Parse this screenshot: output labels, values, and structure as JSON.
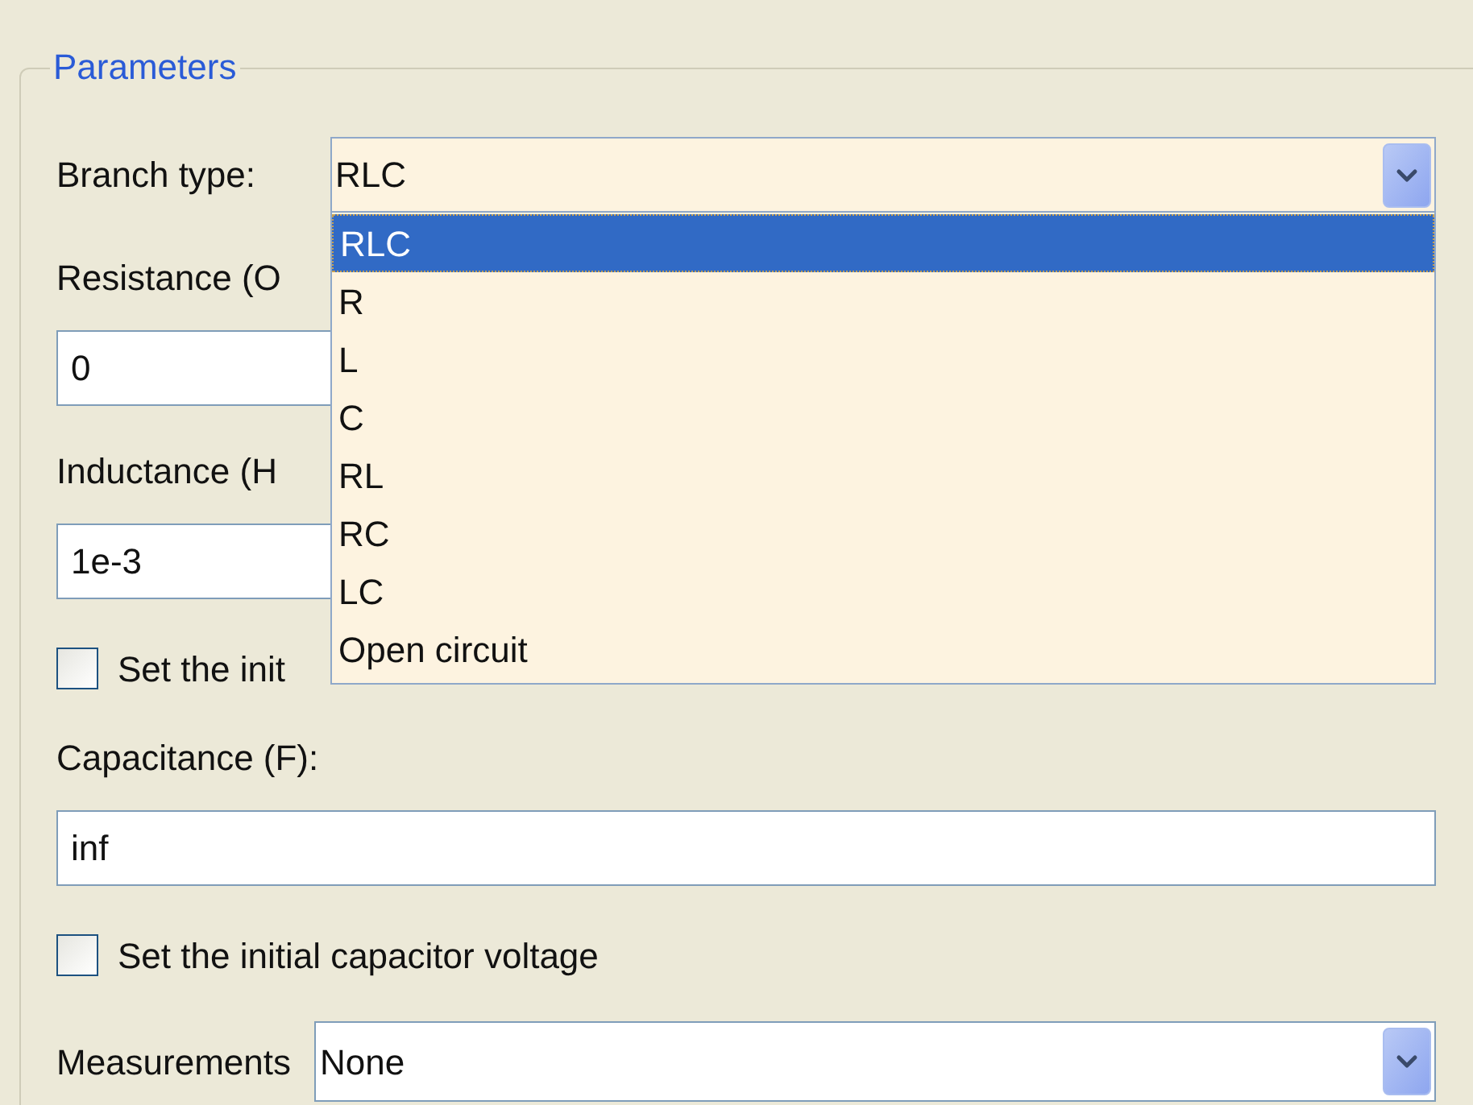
{
  "group": {
    "title": "Parameters"
  },
  "branch_type": {
    "label": "Branch type:",
    "value": "RLC",
    "expanded": true,
    "options": [
      {
        "label": "RLC",
        "selected": true
      },
      {
        "label": "R",
        "selected": false
      },
      {
        "label": "L",
        "selected": false
      },
      {
        "label": "C",
        "selected": false
      },
      {
        "label": "RL",
        "selected": false
      },
      {
        "label": "RC",
        "selected": false
      },
      {
        "label": "LC",
        "selected": false
      },
      {
        "label": "Open circuit",
        "selected": false
      }
    ]
  },
  "fields": [
    {
      "kind": "text",
      "label": "Resistance (O",
      "value": "0"
    },
    {
      "kind": "text",
      "label": "Inductance (H",
      "value": "1e-3"
    },
    {
      "kind": "checkbox",
      "label": "Set the init",
      "checked": false
    },
    {
      "kind": "text",
      "label": "Capacitance (F):",
      "value": "inf"
    },
    {
      "kind": "checkbox",
      "label": "Set the initial capacitor voltage",
      "checked": false
    }
  ],
  "measurements": {
    "label": "Measurements",
    "value": "None"
  }
}
